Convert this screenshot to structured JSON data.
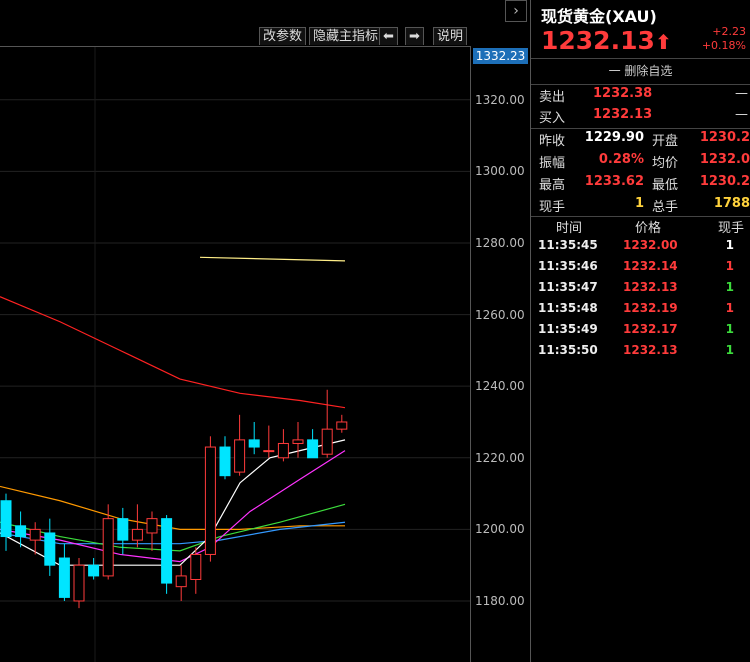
{
  "toolbar": {
    "change_params": "改参数",
    "hide_main": "隐藏主指标",
    "left_arrow": "⬅",
    "right_arrow": "➡",
    "help": "说明"
  },
  "collapse_icon": "chevron-right-icon",
  "price_tag": "1332.23",
  "y_ticks": [
    "1320.00",
    "1300.00",
    "1280.00",
    "1260.00",
    "1240.00",
    "1220.00",
    "1200.00",
    "1180.00"
  ],
  "quote": {
    "title": "现货黄金(XAU)",
    "price": "1232.13",
    "arrow": "⬆",
    "change": "+2.23",
    "change_pct": "+0.18%",
    "delete_label": "一 删除自选",
    "sell_label": "卖出",
    "sell_value": "1232.38",
    "sell_dash": "—",
    "buy_label": "买入",
    "buy_value": "1232.13",
    "buy_dash": "—",
    "prev_close_label": "昨收",
    "prev_close": "1229.90",
    "open_label": "开盘",
    "open": "1230.2",
    "amplitude_label": "振幅",
    "amplitude": "0.28%",
    "avg_label": "均价",
    "avg": "1232.0",
    "high_label": "最高",
    "high": "1233.62",
    "low_label": "最低",
    "low": "1230.2",
    "cur_vol_label": "现手",
    "cur_vol": "1",
    "total_vol_label": "总手",
    "total_vol": "1788"
  },
  "ticks": {
    "headers": {
      "time": "时间",
      "price": "价格",
      "vol": "现手"
    },
    "rows": [
      {
        "time": "11:35:45",
        "price": "1232.00",
        "vol": "1",
        "color": "#ffffff"
      },
      {
        "time": "11:35:46",
        "price": "1232.14",
        "vol": "1",
        "color": "#ff3b3b"
      },
      {
        "time": "11:35:47",
        "price": "1232.13",
        "vol": "1",
        "color": "#3cdc3c"
      },
      {
        "time": "11:35:48",
        "price": "1232.19",
        "vol": "1",
        "color": "#ff3b3b"
      },
      {
        "time": "11:35:49",
        "price": "1232.17",
        "vol": "1",
        "color": "#3cdc3c"
      },
      {
        "time": "11:35:50",
        "price": "1232.13",
        "vol": "1",
        "color": "#3cdc3c"
      }
    ]
  },
  "colors": {
    "up": "#ff3b3b",
    "down": "#00e5ff",
    "accent": "#1d6fb8",
    "ma5": "#ffffff",
    "ma10": "#ff33ff",
    "ma20": "#3cdc3c",
    "ma60": "#3399ff",
    "ma120": "#ff9900",
    "ma250": "#ff2222",
    "ma_high": "#ffee88"
  },
  "chart_data": {
    "type": "candlestick",
    "ylim": [
      1170,
      1340
    ],
    "candles": [
      {
        "o": 1208,
        "h": 1210,
        "l": 1194,
        "c": 1198
      },
      {
        "o": 1201,
        "h": 1205,
        "l": 1195,
        "c": 1198
      },
      {
        "o": 1197,
        "h": 1202,
        "l": 1193,
        "c": 1200
      },
      {
        "o": 1199,
        "h": 1203,
        "l": 1187,
        "c": 1190
      },
      {
        "o": 1192,
        "h": 1196,
        "l": 1180,
        "c": 1181
      },
      {
        "o": 1180,
        "h": 1192,
        "l": 1178,
        "c": 1190
      },
      {
        "o": 1190,
        "h": 1192,
        "l": 1186,
        "c": 1187
      },
      {
        "o": 1187,
        "h": 1207,
        "l": 1186,
        "c": 1203
      },
      {
        "o": 1203,
        "h": 1206,
        "l": 1193,
        "c": 1197
      },
      {
        "o": 1197,
        "h": 1207,
        "l": 1195,
        "c": 1200
      },
      {
        "o": 1199,
        "h": 1205,
        "l": 1194,
        "c": 1203
      },
      {
        "o": 1203,
        "h": 1204,
        "l": 1182,
        "c": 1185
      },
      {
        "o": 1184,
        "h": 1190,
        "l": 1180,
        "c": 1187
      },
      {
        "o": 1186,
        "h": 1195,
        "l": 1182,
        "c": 1193
      },
      {
        "o": 1193,
        "h": 1226,
        "l": 1191,
        "c": 1223
      },
      {
        "o": 1223,
        "h": 1226,
        "l": 1214,
        "c": 1215
      },
      {
        "o": 1216,
        "h": 1232,
        "l": 1215,
        "c": 1225
      },
      {
        "o": 1225,
        "h": 1230,
        "l": 1221,
        "c": 1223
      },
      {
        "o": 1222,
        "h": 1229,
        "l": 1220,
        "c": 1222
      },
      {
        "o": 1220,
        "h": 1228,
        "l": 1219,
        "c": 1224
      },
      {
        "o": 1224,
        "h": 1230,
        "l": 1220,
        "c": 1225
      },
      {
        "o": 1225,
        "h": 1228,
        "l": 1222,
        "c": 1220
      },
      {
        "o": 1221,
        "h": 1239,
        "l": 1220,
        "c": 1228
      },
      {
        "o": 1228,
        "h": 1232,
        "l": 1227,
        "c": 1230
      }
    ],
    "ma_lines": [
      {
        "color": "#ffee88",
        "points": [
          [
            200,
            1276
          ],
          [
            345,
            1275
          ]
        ]
      },
      {
        "color": "#ff2222",
        "points": [
          [
            0,
            1265
          ],
          [
            60,
            1258
          ],
          [
            120,
            1250
          ],
          [
            180,
            1242
          ],
          [
            240,
            1238
          ],
          [
            300,
            1236
          ],
          [
            345,
            1234
          ]
        ]
      },
      {
        "color": "#ff9900",
        "points": [
          [
            0,
            1212
          ],
          [
            60,
            1208
          ],
          [
            120,
            1203
          ],
          [
            180,
            1200
          ],
          [
            240,
            1200
          ],
          [
            300,
            1201
          ],
          [
            345,
            1201
          ]
        ]
      },
      {
        "color": "#3399ff",
        "points": [
          [
            0,
            1199
          ],
          [
            60,
            1196
          ],
          [
            120,
            1196
          ],
          [
            180,
            1196
          ],
          [
            220,
            1197
          ],
          [
            280,
            1200
          ],
          [
            345,
            1202
          ]
        ]
      },
      {
        "color": "#3cdc3c",
        "points": [
          [
            0,
            1202
          ],
          [
            60,
            1198
          ],
          [
            120,
            1195
          ],
          [
            180,
            1194
          ],
          [
            220,
            1198
          ],
          [
            280,
            1202
          ],
          [
            345,
            1207
          ]
        ]
      },
      {
        "color": "#ff33ff",
        "points": [
          [
            0,
            1200
          ],
          [
            60,
            1197
          ],
          [
            120,
            1193
          ],
          [
            180,
            1191
          ],
          [
            210,
            1195
          ],
          [
            250,
            1205
          ],
          [
            300,
            1214
          ],
          [
            345,
            1222
          ]
        ]
      },
      {
        "color": "#ffffff",
        "points": [
          [
            0,
            1199
          ],
          [
            60,
            1190
          ],
          [
            120,
            1190
          ],
          [
            180,
            1190
          ],
          [
            210,
            1198
          ],
          [
            240,
            1213
          ],
          [
            270,
            1220
          ],
          [
            300,
            1222
          ],
          [
            345,
            1225
          ]
        ]
      }
    ]
  }
}
